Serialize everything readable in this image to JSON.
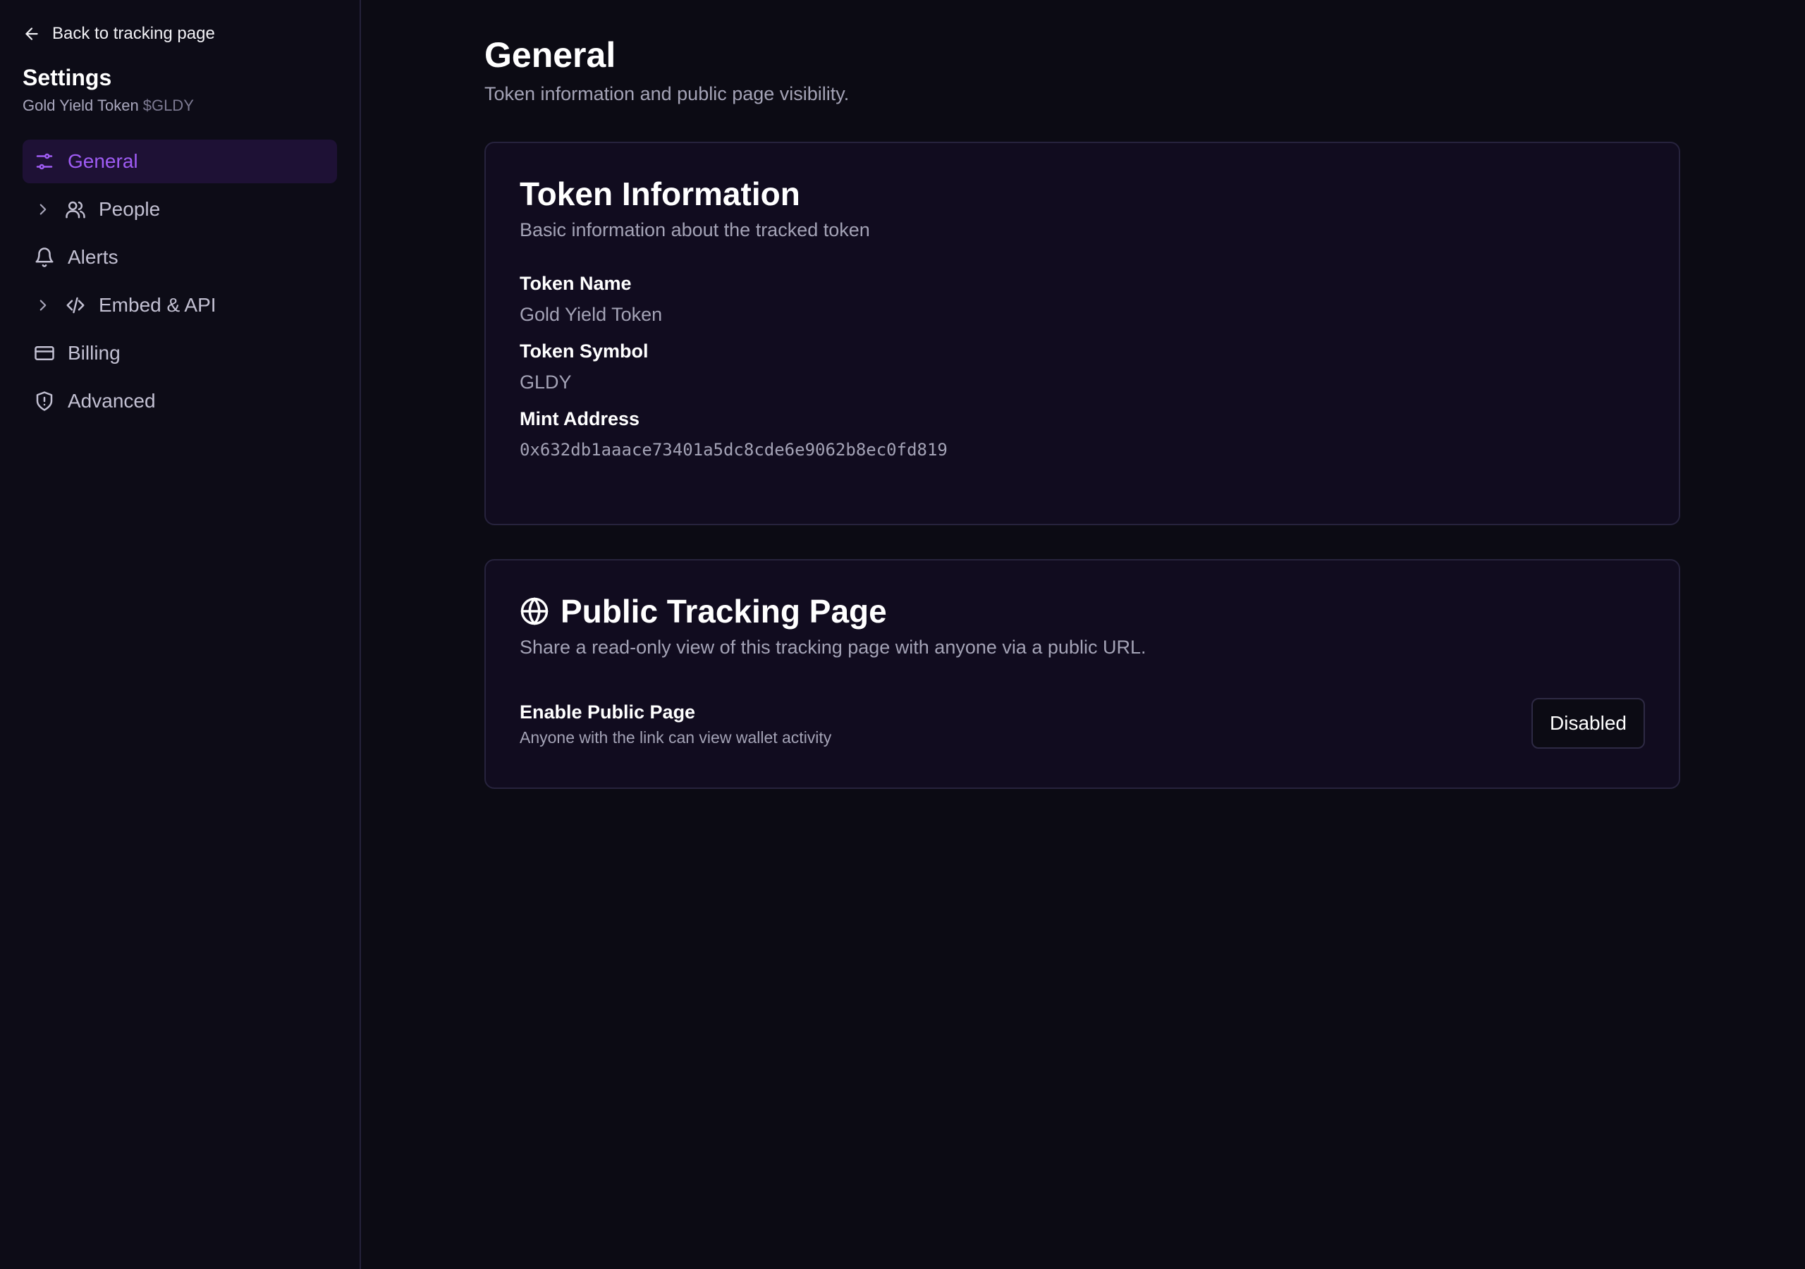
{
  "sidebar": {
    "back_label": "Back to tracking page",
    "title": "Settings",
    "token_name": "Gold Yield Token",
    "token_symbol": "$GLDY",
    "items": [
      {
        "label": "General",
        "icon": "sliders-icon",
        "active": true
      },
      {
        "label": "People",
        "icon": "users-icon",
        "expandable": true
      },
      {
        "label": "Alerts",
        "icon": "bell-icon"
      },
      {
        "label": "Embed & API",
        "icon": "code-icon",
        "expandable": true
      },
      {
        "label": "Billing",
        "icon": "credit-card-icon"
      },
      {
        "label": "Advanced",
        "icon": "shield-alert-icon"
      }
    ]
  },
  "main": {
    "title": "General",
    "subtitle": "Token information and public page visibility."
  },
  "token_info": {
    "title": "Token Information",
    "subtitle": "Basic information about the tracked token",
    "fields": [
      {
        "label": "Token Name",
        "value": "Gold Yield Token"
      },
      {
        "label": "Token Symbol",
        "value": "GLDY"
      },
      {
        "label": "Mint Address",
        "value": "0x632db1aaace73401a5dc8cde6e9062b8ec0fd819"
      }
    ]
  },
  "public_page": {
    "title": "Public Tracking Page",
    "icon": "globe-icon",
    "subtitle": "Share a read-only view of this tracking page with anyone via a public URL.",
    "toggle_label": "Enable Public Page",
    "toggle_description": "Anyone with the link can view wallet activity",
    "button_label": "Disabled"
  },
  "colors": {
    "background": "#0c0b14",
    "card": "#110c1f",
    "accent": "#9f5cf4",
    "active_nav_bg": "#1e1135"
  }
}
